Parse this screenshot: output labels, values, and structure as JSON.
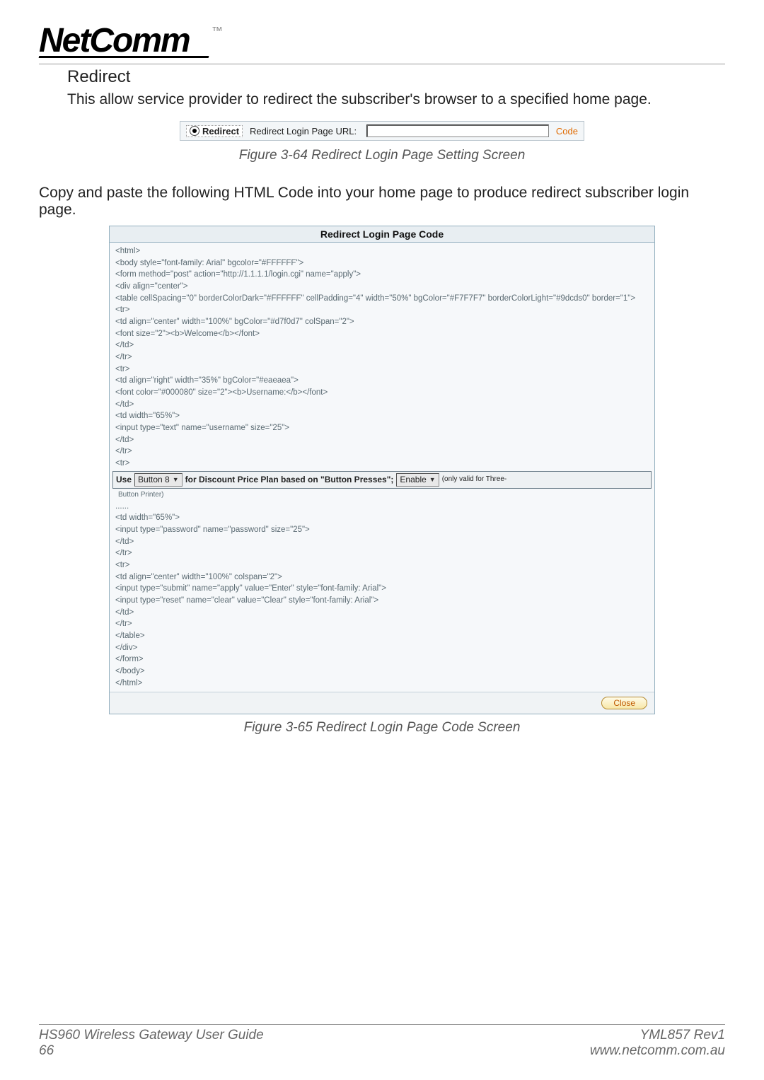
{
  "logo": {
    "text": "NetComm",
    "tm": "™"
  },
  "heading": "Redirect",
  "description": "This allow service provider to redirect the subscriber's browser to a specified home page.",
  "screenshot1": {
    "radio_label": "Redirect",
    "url_label": "Redirect Login Page URL:",
    "url_value": "",
    "code_link": "Code"
  },
  "caption1": "Figure 3-64 Redirect Login Page Setting Screen",
  "copytext": "Copy and paste the following HTML Code into your home page to produce redirect subscriber login page.",
  "panel": {
    "title": "Redirect Login Page Code",
    "code_top": "<html>\n<body style=\"font-family: Arial\" bgcolor=\"#FFFFFF\">\n<form method=\"post\" action=\"http://1.1.1.1/login.cgi\" name=\"apply\">\n<div align=\"center\">\n<table cellSpacing=\"0\" borderColorDark=\"#FFFFFF\" cellPadding=\"4\" width=\"50%\" bgColor=\"#F7F7F7\" borderColorLight=\"#9dcds0\" border=\"1\">\n<tr>\n<td align=\"center\" width=\"100%\" bgColor=\"#d7f0d7\" colSpan=\"2\">\n<font size=\"2\"><b>Welcome</b></font>\n</td>\n</tr>\n<tr>\n<td align=\"right\" width=\"35%\" bgColor=\"#eaeaea\">\n<font color=\"#000080\" size=\"2\"><b>Username:</b></font>\n</td>\n<td width=\"65%\">\n<input type=\"text\" name=\"username\" size=\"25\">\n</td>\n</tr>\n<tr>",
    "insert": {
      "use": "Use",
      "select1": "Button 8",
      "mid": "for Discount Price Plan based on \"Button Presses\";",
      "select2": "Enable",
      "tail": "(only valid for Three-"
    },
    "sub": "Button Printer)",
    "code_bottom": "......\n<td width=\"65%\">\n<input type=\"password\" name=\"password\" size=\"25\">\n</td>\n</tr>\n<tr>\n<td align=\"center\" width=\"100%\" colspan=\"2\">\n<input type=\"submit\" name=\"apply\" value=\"Enter\" style=\"font-family: Arial\">\n<input type=\"reset\" name=\"clear\" value=\"Clear\" style=\"font-family: Arial\">\n</td>\n</tr>\n</table>\n</div>\n</form>\n</body>\n</html>",
    "close": "Close"
  },
  "caption2": "Figure 3-65 Redirect Login Page Code Screen",
  "footer": {
    "left1": "HS960 Wireless Gateway User Guide",
    "left2": "66",
    "right1": "YML857 Rev1",
    "right2": "www.netcomm.com.au"
  }
}
